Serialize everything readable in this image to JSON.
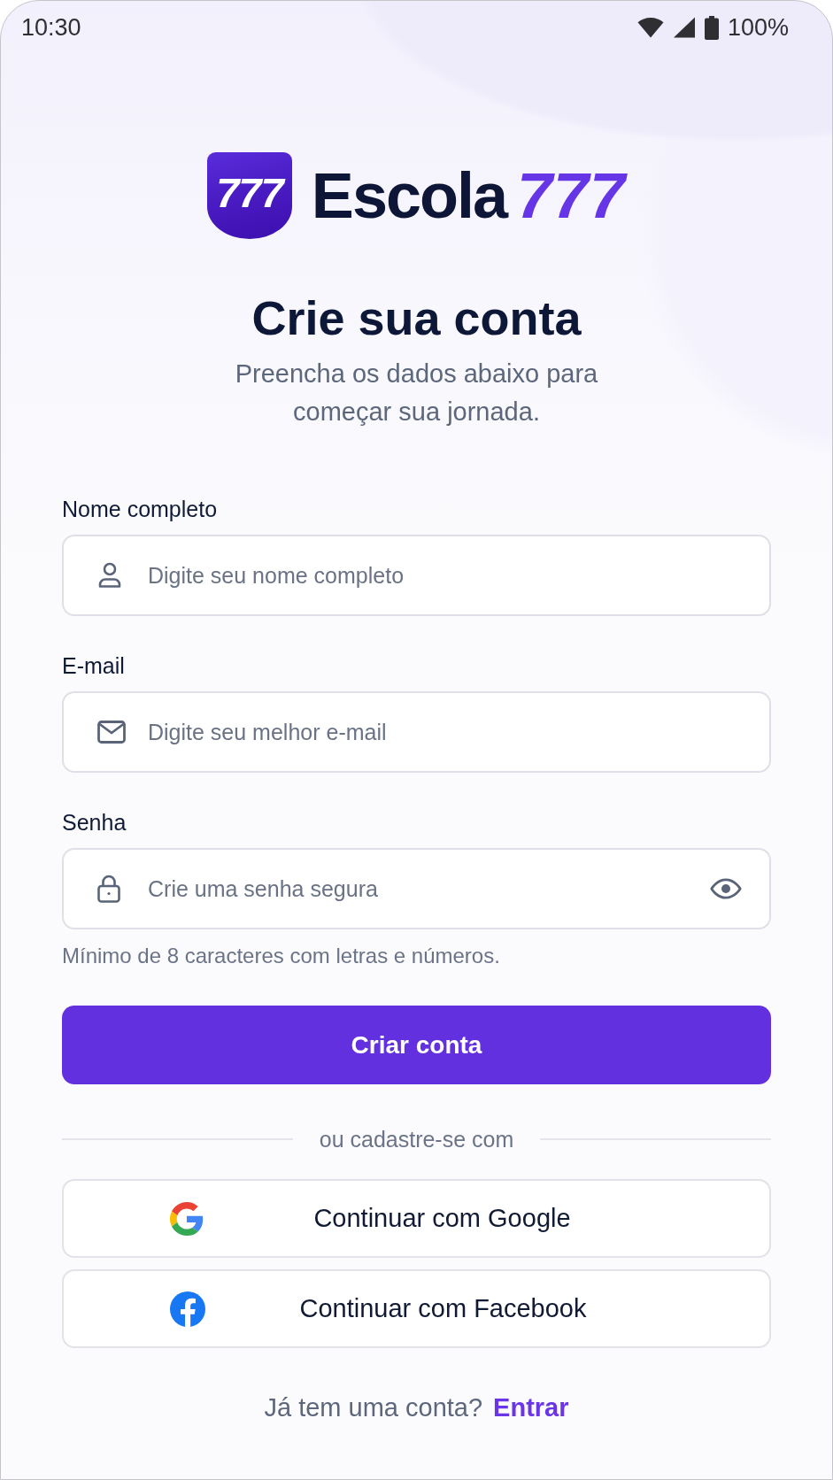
{
  "status_bar": {
    "time": "10:30",
    "battery": "100%"
  },
  "brand": {
    "badge": "777",
    "name": "Escola",
    "number": "777"
  },
  "header": {
    "title": "Crie sua conta",
    "subtitle": "Preencha os dados abaixo para começar sua jornada."
  },
  "form": {
    "fields": [
      {
        "kind": "name",
        "label": "Nome completo",
        "placeholder": "Digite seu nome completo"
      },
      {
        "kind": "email",
        "label": "E-mail",
        "placeholder": "Digite seu melhor e-mail"
      },
      {
        "kind": "password",
        "label": "Senha",
        "placeholder": "Crie uma senha segura",
        "hint": "Mínimo de 8 caracteres com letras e números."
      }
    ],
    "submit": "Criar conta"
  },
  "divider": "ou cadastre-se com",
  "social": [
    {
      "kind": "google",
      "label": "Continuar com Google"
    },
    {
      "kind": "facebook",
      "label": "Continuar com Facebook"
    }
  ],
  "footer": {
    "prompt": "Já tem uma conta?",
    "link": "Entrar"
  }
}
